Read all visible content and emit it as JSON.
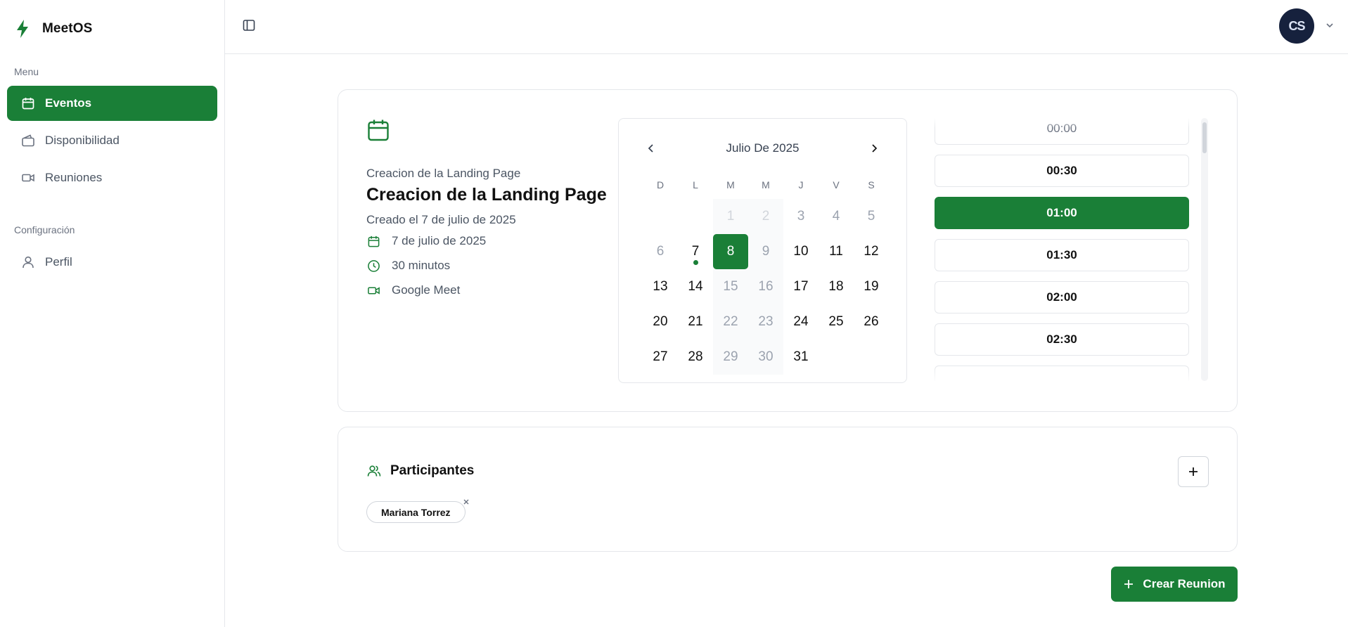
{
  "app": {
    "name": "MeetOS"
  },
  "sidebar": {
    "menu_label": "Menu",
    "config_label": "Configuración",
    "items": [
      {
        "label": "Eventos",
        "icon": "calendar-icon",
        "active": true
      },
      {
        "label": "Disponibilidad",
        "icon": "wallet-icon",
        "active": false
      },
      {
        "label": "Reuniones",
        "icon": "video-icon",
        "active": false
      }
    ],
    "config_items": [
      {
        "label": "Perfil",
        "icon": "user-icon"
      }
    ]
  },
  "header": {
    "avatar_initials": "CS"
  },
  "event": {
    "subtitle": "Creacion de la Landing Page",
    "title": "Creacion de la Landing Page",
    "created": "Creado el 7 de julio de 2025",
    "date": "7 de julio de 2025",
    "duration": "30 minutos",
    "platform": "Google Meet"
  },
  "calendar": {
    "month_label": "Julio De 2025",
    "weekdays": [
      "D",
      "L",
      "M",
      "M",
      "J",
      "V",
      "S"
    ],
    "weeks": [
      [
        "",
        "",
        "1",
        "2",
        "3",
        "4",
        "5"
      ],
      [
        "6",
        "7",
        "8",
        "9",
        "10",
        "11",
        "12"
      ],
      [
        "13",
        "14",
        "15",
        "16",
        "17",
        "18",
        "19"
      ],
      [
        "20",
        "21",
        "22",
        "23",
        "24",
        "25",
        "26"
      ],
      [
        "27",
        "28",
        "29",
        "30",
        "31",
        "",
        ""
      ]
    ],
    "selected_day": "8",
    "today_marker_day": "7"
  },
  "time_slots": {
    "items": [
      "00:00",
      "00:30",
      "01:00",
      "01:30",
      "02:00",
      "02:30"
    ],
    "selected": "01:00"
  },
  "participants": {
    "title": "Participantes",
    "list": [
      "Mariana Torrez"
    ]
  },
  "actions": {
    "create_label": "Crear Reunion"
  },
  "colors": {
    "accent": "#1a7f37",
    "avatar_bg": "#16213d"
  }
}
